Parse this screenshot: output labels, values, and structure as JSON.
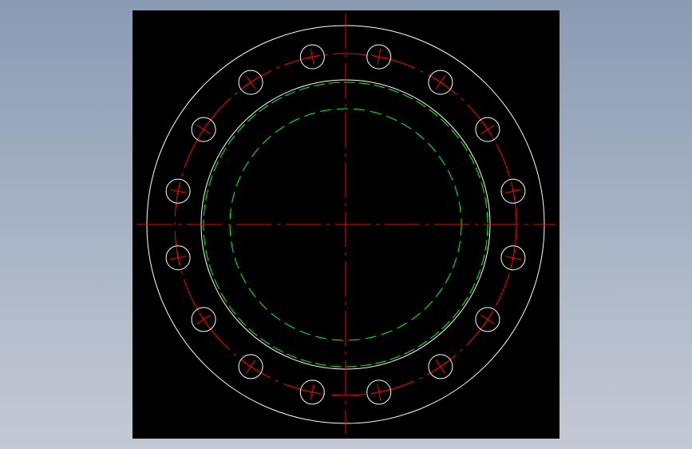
{
  "colors": {
    "background_gradient_top": "#8a9bb4",
    "background_gradient_bottom": "#c4cad5",
    "viewport_background": "#000000",
    "outline": "#ffffff",
    "centerline": "#ff0000",
    "hidden_line": "#00ff00"
  },
  "drawing": {
    "view": "flange-top-view",
    "bolt_hole_count": 16
  }
}
